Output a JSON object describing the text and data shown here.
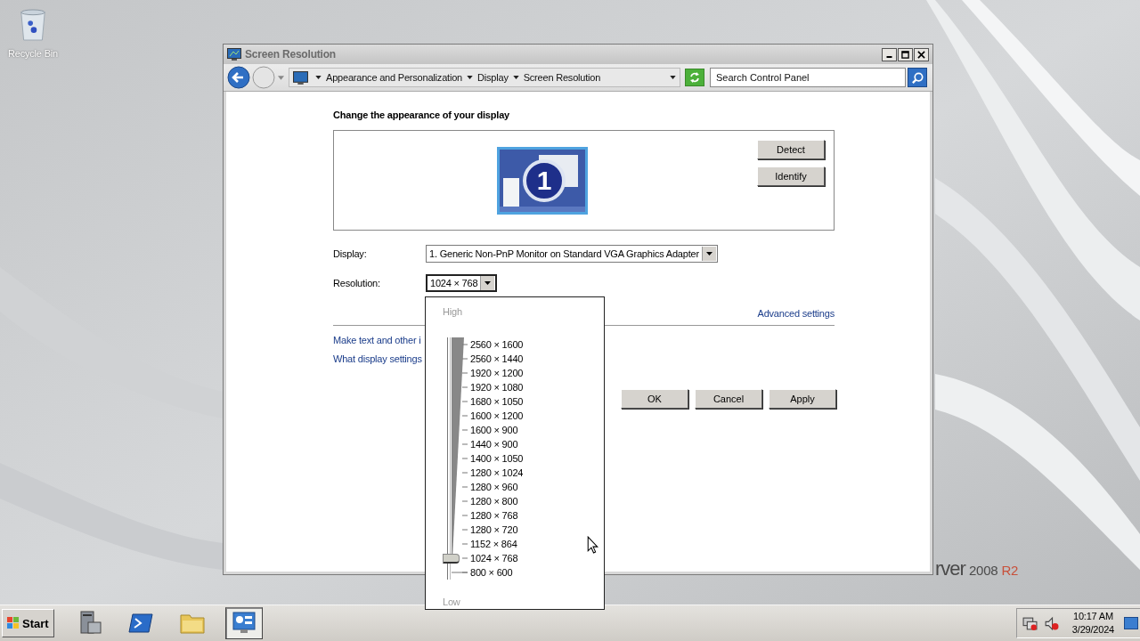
{
  "desktop_icons": [
    {
      "label": "Recycle Bin"
    }
  ],
  "window": {
    "title": "Screen Resolution",
    "breadcrumb": [
      "Appearance and Personalization",
      "Display",
      "Screen Resolution"
    ],
    "search": {
      "placeholder": "Search Control Panel"
    },
    "heading": "Change the appearance of your display",
    "monitor_number": "1",
    "side_buttons": [
      "Detect",
      "Identify"
    ],
    "display": {
      "label": "Display:",
      "value": "1. Generic Non-PnP Monitor on Standard VGA Graphics Adapter"
    },
    "resolution": {
      "label": "Resolution:",
      "value": "1024 × 768",
      "expanded": true
    },
    "advanced_link": "Advanced settings",
    "links": [
      "Make text and other i",
      "What display settings"
    ],
    "buttons": [
      "OK",
      "Cancel",
      "Apply"
    ]
  },
  "resolution_popup": {
    "high_label": "High",
    "low_label": "Low",
    "level": 0.0625,
    "options": [
      "2560 × 1600",
      "2560 × 1440",
      "1920 × 1200",
      "1920 × 1080",
      "1680 × 1050",
      "1600 × 1200",
      "1600 × 900",
      "1440 × 900",
      "1400 × 1050",
      "1280 × 1024",
      "1280 × 960",
      "1280 × 800",
      "1280 × 768",
      "1280 × 720",
      "1152 × 864",
      "1024 × 768",
      "800 × 600"
    ]
  },
  "branding": [
    "rver",
    "2008",
    "R2"
  ],
  "taskbar": {
    "start": "Start",
    "apps": [
      {
        "kind": "server",
        "selected": false
      },
      {
        "kind": "shell",
        "selected": false
      },
      {
        "kind": "folder",
        "selected": false
      },
      {
        "kind": "control-panel",
        "selected": true
      }
    ],
    "clock": {
      "time": "10:17 AM",
      "date": "3/29/2024"
    }
  }
}
